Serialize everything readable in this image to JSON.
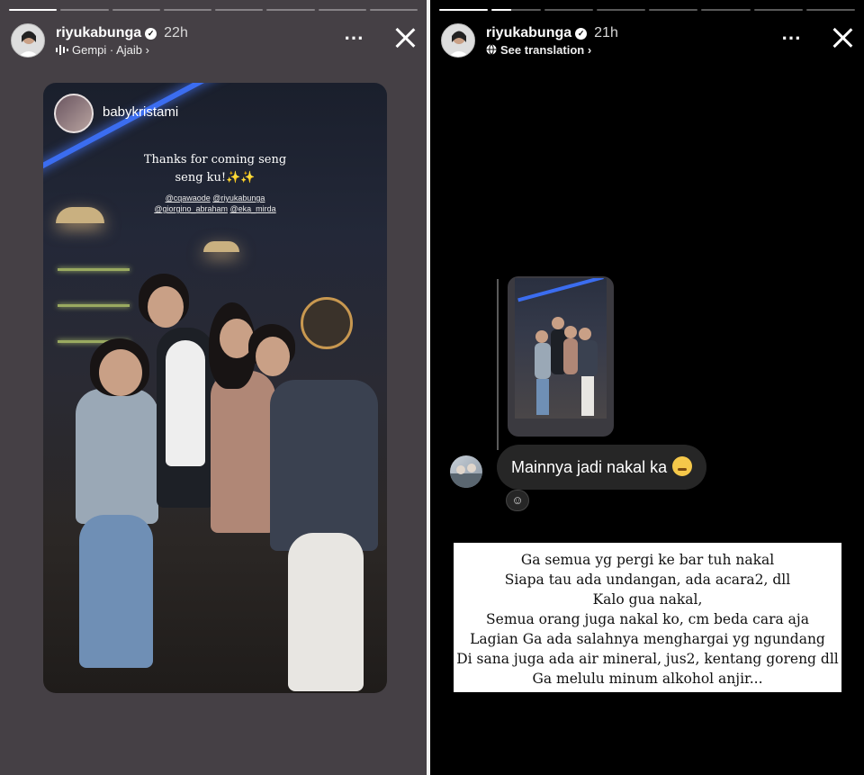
{
  "left_story": {
    "username": "riyukabunga",
    "time": "22h",
    "music": "Gempi · Ajaib",
    "music_chevron": "›",
    "progress": {
      "total_segments": 8,
      "completed_segments": 1
    },
    "shared_post": {
      "username": "babykristami",
      "caption_line1": "Thanks for coming seng",
      "caption_line2": "seng ku!✨✨",
      "tags": [
        "@cqawaode",
        "@riyukabunga",
        "@giorgino_abraham",
        "@eka_mirda"
      ]
    }
  },
  "right_story": {
    "username": "riyukabunga",
    "time": "21h",
    "see_translation": "See translation",
    "translation_chevron": "›",
    "progress": {
      "total_segments": 8,
      "completed_segments": 2
    },
    "comment": {
      "text": "Mainnya jadi nakal ka",
      "emoji": "face-savoring-food-icon"
    },
    "reply_lines": [
      "Ga semua yg pergi ke bar tuh nakal",
      "Siapa tau ada undangan, ada acara2, dll",
      "Kalo gua nakal,",
      "Semua orang juga nakal ko, cm beda cara aja",
      "Lagian Ga ada salahnya menghargai yg ngundang",
      "Di sana juga ada air mineral, jus2, kentang goreng dll",
      "Ga melulu minum alkohol anjir..."
    ]
  },
  "icons": {
    "more": "⋯",
    "verified": "✓",
    "music": "music-bars-icon",
    "globe": "globe-icon",
    "reaction": "☺"
  },
  "colors": {
    "left_background": "#454045",
    "right_background": "#000000",
    "comment_bubble": "#262626"
  }
}
